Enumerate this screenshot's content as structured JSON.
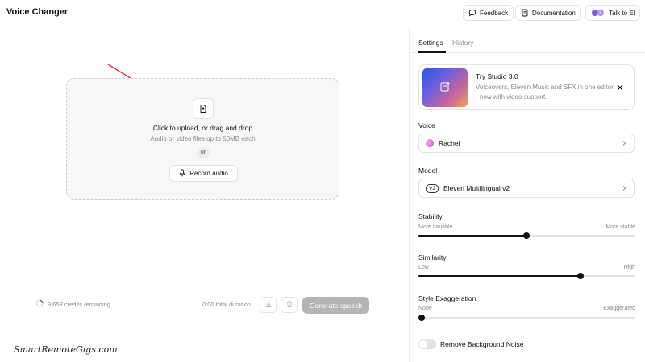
{
  "header": {
    "title": "Voice Changer",
    "feedback_label": "Feedback",
    "documentation_label": "Documentation",
    "talk_label": "Talk to El"
  },
  "upload": {
    "title": "Click to upload, or drag and drop",
    "subtitle": "Audio or video files up to 50MB each",
    "or_label": "or",
    "record_label": "Record audio"
  },
  "footer": {
    "credits": "9,658 credits remaining",
    "duration": "0:00 total duration",
    "generate_label": "Generate speech"
  },
  "watermark": "SmartRemoteGigs.com",
  "settings": {
    "tabs": [
      {
        "label": "Settings",
        "active": true
      },
      {
        "label": "History",
        "active": false
      }
    ],
    "promo": {
      "title": "Try Studio 3.0",
      "description": "Voiceovers, Eleven Music and SFX in one editor - now with video support."
    },
    "voice": {
      "label": "Voice",
      "value": "Rachel"
    },
    "model": {
      "label": "Model",
      "badge": "V2",
      "value": "Eleven Multilingual v2"
    },
    "sliders": {
      "stability": {
        "label": "Stability",
        "min_label": "More variable",
        "max_label": "More stable",
        "value": 0.5
      },
      "similarity": {
        "label": "Similarity",
        "min_label": "Low",
        "max_label": "High",
        "value": 0.75
      },
      "style": {
        "label": "Style Exaggeration",
        "min_label": "None",
        "max_label": "Exaggerated",
        "value": 0.0
      }
    },
    "remove_noise": {
      "label": "Remove Background Noise",
      "enabled": false
    }
  },
  "colors": {
    "accent": "#111111",
    "annotation_arrow": "#e03a3a",
    "disabled_button": "#b5b5b5"
  }
}
